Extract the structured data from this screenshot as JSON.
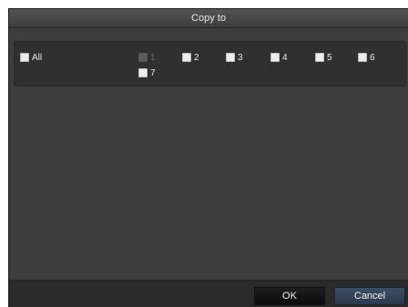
{
  "dialog": {
    "title": "Copy to"
  },
  "channels": {
    "all_label": "All",
    "items": [
      {
        "label": "1",
        "enabled": false,
        "checked": false
      },
      {
        "label": "2",
        "enabled": true,
        "checked": false
      },
      {
        "label": "3",
        "enabled": true,
        "checked": false
      },
      {
        "label": "4",
        "enabled": true,
        "checked": false
      },
      {
        "label": "5",
        "enabled": true,
        "checked": false
      },
      {
        "label": "6",
        "enabled": true,
        "checked": false
      },
      {
        "label": "7",
        "enabled": true,
        "checked": false
      }
    ]
  },
  "footer": {
    "ok_label": "OK",
    "cancel_label": "Cancel"
  },
  "colors": {
    "dialog_bg": "#3a3a3a",
    "title_text": "#e6e6e6",
    "cancel_accent": "#34465c"
  }
}
